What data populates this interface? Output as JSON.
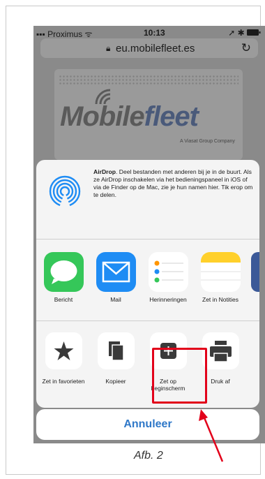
{
  "status_bar": {
    "carrier": "Proximus",
    "time": "10:13"
  },
  "browser": {
    "url": "eu.mobilefleet.es"
  },
  "website": {
    "logo_mobile": "Mobile",
    "logo_fleet": "fleet",
    "tagline": "A Viasat Group Company"
  },
  "airdrop": {
    "title": "AirDrop",
    "description": ". Deel bestanden met anderen bij je in de buurt. Als ze AirDrop inschakelen via het bedieningspaneel in iOS of via de Finder op de Mac, zie je hun namen hier. Tik erop om te delen."
  },
  "apps": [
    {
      "label": "Bericht",
      "icon": "messages-icon"
    },
    {
      "label": "Mail",
      "icon": "mail-icon"
    },
    {
      "label": "Herinneringen",
      "icon": "reminders-icon"
    },
    {
      "label": "Zet in Notities",
      "icon": "notes-icon"
    }
  ],
  "actions": [
    {
      "label": "Zet in favorieten",
      "icon": "star-icon"
    },
    {
      "label": "Kopieer",
      "icon": "copy-icon"
    },
    {
      "label": "Zet op beginscherm",
      "icon": "add-to-home-icon"
    },
    {
      "label": "Druk af",
      "icon": "print-icon"
    }
  ],
  "cancel_label": "Annuleer",
  "caption": "Afb. 2",
  "colors": {
    "highlight": "#e2001a",
    "link_blue": "#2f78c8",
    "messages_green": "#35c759",
    "mail_blue": "#1e8cf4",
    "notes_yellow": "#ffd02b"
  }
}
